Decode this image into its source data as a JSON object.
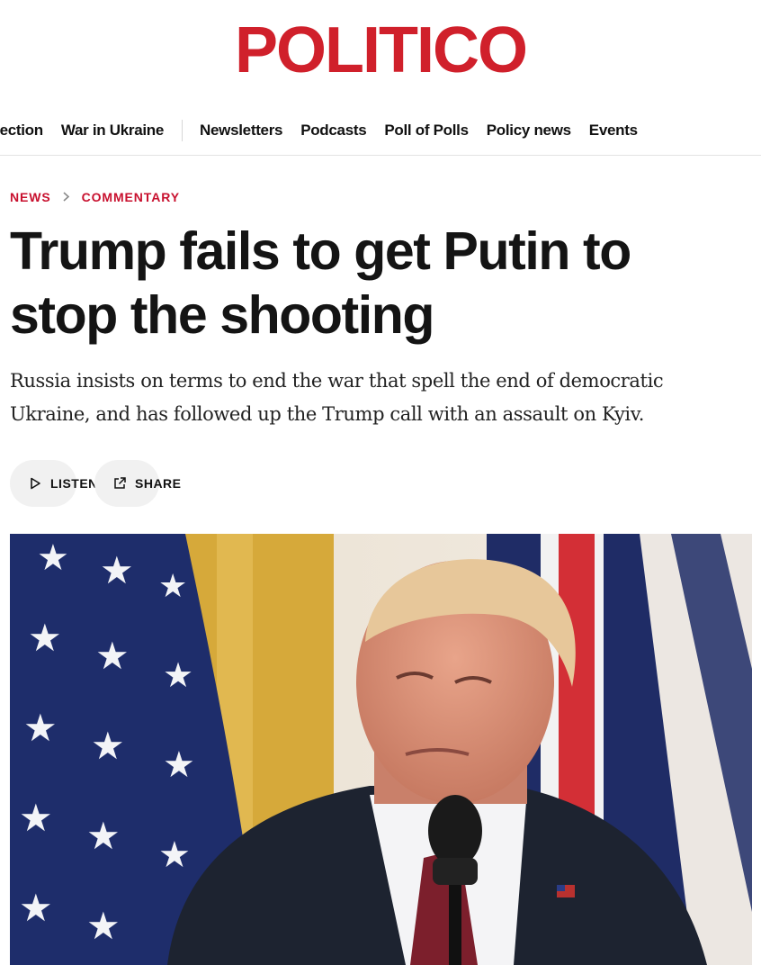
{
  "masthead": {
    "logo_text": "POLITICO"
  },
  "nav": {
    "items": [
      {
        "label": "election"
      },
      {
        "label": "War in Ukraine"
      },
      {
        "label": "Newsletters"
      },
      {
        "label": "Podcasts"
      },
      {
        "label": "Poll of Polls"
      },
      {
        "label": "Policy news"
      },
      {
        "label": "Events"
      }
    ]
  },
  "breadcrumb": {
    "section": "NEWS",
    "subsection": "COMMENTARY"
  },
  "article": {
    "headline": "Trump fails to get Putin to stop the shooting",
    "dek": "Russia insists on terms to end the war that spell the end of democratic Ukraine, and has followed up the Trump call with an assault on Kyiv."
  },
  "actions": {
    "listen_label": "LISTEN",
    "share_label": "SHARE"
  },
  "icons": {
    "breadcrumb_separator": "chevron-right-icon",
    "listen": "play-icon",
    "share": "share-external-icon"
  },
  "colors": {
    "brand_red": "#d0202b",
    "breadcrumb_red": "#c8102e",
    "pill_bg": "#f1f1f1"
  }
}
